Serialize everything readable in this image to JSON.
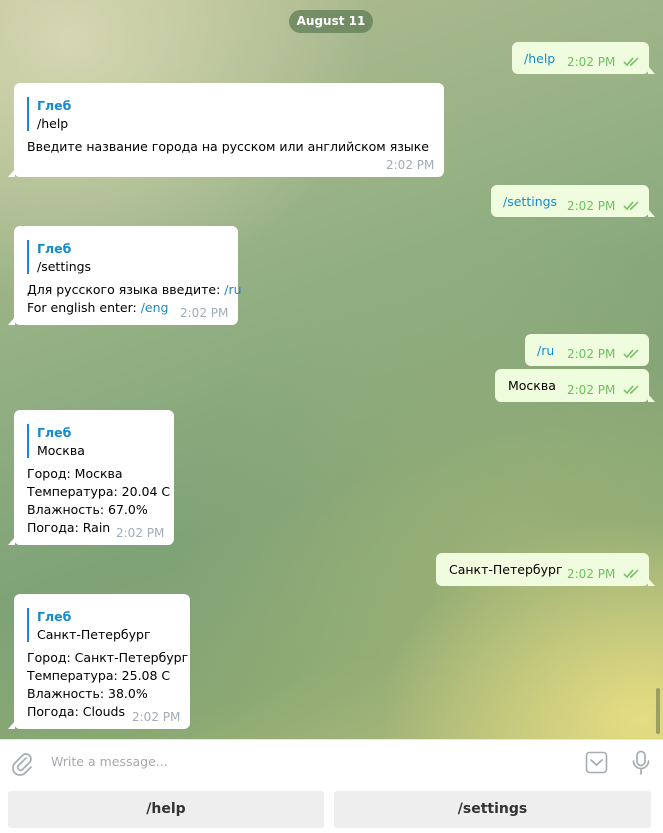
{
  "chat": {
    "date": "August 11",
    "messages": [
      {
        "dir": "out",
        "text": "/help",
        "time": "2:02 PM",
        "is_command": true
      },
      {
        "dir": "in",
        "quote_name": "Глеб",
        "quote_text": "/help",
        "lines": [
          "Введите название города на русском или английском языке"
        ],
        "time": "2:02 PM"
      },
      {
        "dir": "out",
        "text": "/settings",
        "time": "2:02 PM",
        "is_command": true
      },
      {
        "dir": "in",
        "quote_name": "Глеб",
        "quote_text": "/settings",
        "lines": [
          "Для русского языка введите: ",
          "For english enter: "
        ],
        "line_cmds": [
          "/ru",
          "/eng"
        ],
        "time": "2:02 PM"
      },
      {
        "dir": "out",
        "text": "/ru",
        "time": "2:02 PM",
        "is_command": true
      },
      {
        "dir": "out",
        "text": "Москва",
        "time": "2:02 PM",
        "is_command": false
      },
      {
        "dir": "in",
        "quote_name": "Глеб",
        "quote_text": "Москва",
        "lines": [
          "Город: Москва",
          "Температура: 20.04 C",
          "Влажность: 67.0%",
          "Погода: Rain"
        ],
        "time": "2:02 PM"
      },
      {
        "dir": "out",
        "text": "Санкт-Петербург",
        "time": "2:02 PM",
        "is_command": false
      },
      {
        "dir": "in",
        "quote_name": "Глеб",
        "quote_text": "Санкт-Петербург",
        "lines": [
          "Город: Санкт-Петербург",
          "Температура: 25.08 C",
          "Влажность: 38.0%",
          "Погода: Clouds"
        ],
        "time": "2:02 PM"
      }
    ]
  },
  "composer": {
    "placeholder": "Write a message...",
    "icons": [
      "paperclip-icon",
      "bot-keyboard-icon",
      "microphone-icon"
    ]
  },
  "keyboard": {
    "buttons": [
      "/help",
      "/settings"
    ]
  },
  "colors": {
    "outgoing_bubble": "#effdde",
    "incoming_bubble": "#ffffff",
    "link": "#168acd",
    "outgoing_time": "#6cbf5e",
    "incoming_time": "#a0acb6",
    "date_pill": "#5f7d55"
  }
}
